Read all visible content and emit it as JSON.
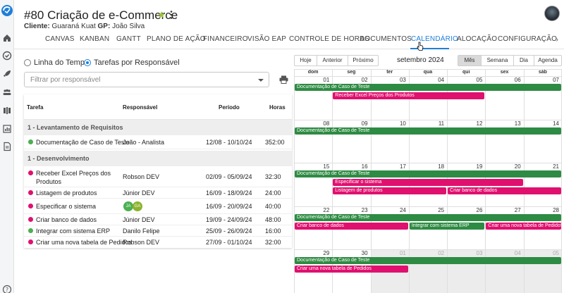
{
  "colors": {
    "accent": "#1e7fd8",
    "event_green": "#2e8b43",
    "event_pink": "#e0106f",
    "status_green": "#4caf50",
    "status_pink": "#e0106f"
  },
  "sidebar": {
    "logo_icon": "app-logo-icon",
    "items": [
      {
        "name": "home-icon"
      },
      {
        "name": "check-circle-icon"
      },
      {
        "name": "rocket-icon"
      },
      {
        "name": "team-icon"
      },
      {
        "name": "layers-icon"
      },
      {
        "name": "chart-icon"
      },
      {
        "name": "document-icon"
      }
    ],
    "help_icon": "help-icon"
  },
  "header": {
    "title": "#80 Criação de e-Commerce",
    "client_label": "Cliente:",
    "client_value": "Guaraná Kuat",
    "gp_label": "GP:",
    "gp_value": "João Silva"
  },
  "tabs": [
    {
      "label": "CANVAS"
    },
    {
      "label": "KANBAN"
    },
    {
      "label": "GANTT"
    },
    {
      "label": "PLANO DE AÇÃO"
    },
    {
      "label": "FINANCEIRO"
    },
    {
      "label": "VISÃO EAP"
    },
    {
      "label": "CONTROLE DE HORAS"
    },
    {
      "label": "DOCUMENTOS"
    },
    {
      "label": "CALENDÁRIO"
    },
    {
      "label": "ALOCAÇÃO"
    },
    {
      "label": "CONFIGURAÇÃO"
    }
  ],
  "tabs_arrow": "›",
  "view_options": {
    "timeline": "Linha do Tempo",
    "by_responsible": "Tarefas por Responsável"
  },
  "filter": {
    "placeholder": "Filtrar por responsável"
  },
  "table": {
    "headers": {
      "task": "Tarefa",
      "responsible": "Responsável",
      "period": "Período",
      "hours": "Horas"
    },
    "groups": [
      {
        "title": "1 - Levantamento de Requisitos",
        "rows": [
          {
            "task": "Documentação de Caso de Teste",
            "responsible": "João - Analista",
            "period": "12/08 - 10/10/24",
            "hours": "352:00",
            "status": "green"
          }
        ]
      },
      {
        "title": "1 - Desenvolvimento",
        "rows": [
          {
            "task": "Receber Excel Preços dos",
            "task2": "Produtos",
            "responsible": "Robson DEV",
            "period": "02/09 - 05/09/24",
            "hours": "32:30",
            "status": "pink"
          },
          {
            "task": "Listagem de produtos",
            "responsible": "Júnior DEV",
            "period": "16/09 - 18/09/24",
            "hours": "24:00",
            "status": "pink"
          },
          {
            "task": "Especificar o sistema",
            "chips": [
              "JA",
              "GA"
            ],
            "period": "16/09 - 20/09/24",
            "hours": "40:00",
            "status": "pink"
          },
          {
            "task": "Criar banco de dados",
            "responsible": "Júnior DEV",
            "period": "19/09 - 24/09/24",
            "hours": "48:00",
            "status": "pink"
          },
          {
            "task": "Integrar com sistema ERP",
            "responsible": "Danilo Felipe",
            "period": "25/09 - 26/09/24",
            "hours": "16:00",
            "status": "green"
          },
          {
            "task": "Criar uma nova tabela de Pedidos",
            "responsible": "Robson DEV",
            "period": "27/09 - 01/10/24",
            "hours": "32:00",
            "status": "pink"
          }
        ]
      }
    ]
  },
  "calendar": {
    "nav": {
      "today": "Hoje",
      "prev": "Anterior",
      "next": "Próximo"
    },
    "title": "setembro 2024",
    "views": {
      "month": "Mês",
      "week": "Semana",
      "day": "Dia",
      "agenda": "Agenda"
    },
    "weekdays": [
      "dom",
      "seg",
      "ter",
      "qua",
      "qui",
      "sex",
      "sáb"
    ],
    "weeks": [
      {
        "days": [
          "01",
          "02",
          "03",
          "04",
          "05",
          "06",
          "07"
        ]
      },
      {
        "days": [
          "08",
          "09",
          "10",
          "11",
          "12",
          "13",
          "14"
        ]
      },
      {
        "days": [
          "15",
          "16",
          "17",
          "18",
          "19",
          "20",
          "21"
        ]
      },
      {
        "days": [
          "22",
          "23",
          "24",
          "25",
          "26",
          "27",
          "28"
        ]
      },
      {
        "days": [
          "29",
          "30",
          "01",
          "02",
          "03",
          "04",
          "05"
        ]
      }
    ],
    "events": [
      {
        "week": 0,
        "start": 0,
        "span": 7,
        "lane": 0,
        "color": "green",
        "label": "Documentação de Caso de Teste"
      },
      {
        "week": 0,
        "start": 1,
        "span": 4,
        "lane": 1,
        "color": "pink",
        "label": "Receber Excel Preços dos Produtos"
      },
      {
        "week": 1,
        "start": 0,
        "span": 7,
        "lane": 0,
        "color": "green",
        "label": "Documentação de Caso de Teste"
      },
      {
        "week": 2,
        "start": 0,
        "span": 7,
        "lane": 0,
        "color": "green",
        "label": "Documentação de Caso de Teste"
      },
      {
        "week": 2,
        "start": 1,
        "span": 5,
        "lane": 1,
        "color": "pink",
        "label": "Especificar o sistema"
      },
      {
        "week": 2,
        "start": 1,
        "span": 3,
        "lane": 2,
        "color": "pink",
        "label": "Listagem de produtos"
      },
      {
        "week": 2,
        "start": 4,
        "span": 3,
        "lane": 2,
        "color": "pink",
        "label": "Criar banco de dados"
      },
      {
        "week": 3,
        "start": 0,
        "span": 7,
        "lane": 0,
        "color": "green",
        "label": "Documentação de Caso de Teste"
      },
      {
        "week": 3,
        "start": 0,
        "span": 3,
        "lane": 1,
        "color": "pink",
        "label": "Criar banco de dados"
      },
      {
        "week": 3,
        "start": 3,
        "span": 2,
        "lane": 1,
        "color": "green",
        "label": "Integrar com sistema ERP"
      },
      {
        "week": 3,
        "start": 5,
        "span": 2,
        "lane": 1,
        "color": "pink",
        "label": "Criar uma nova tabela de Pedidos"
      },
      {
        "week": 4,
        "start": 0,
        "span": 7,
        "lane": 0,
        "color": "green",
        "label": "Documentação de Caso de Teste"
      },
      {
        "week": 4,
        "start": 0,
        "span": 3,
        "lane": 1,
        "color": "pink",
        "label": "Criar uma nova tabela de Pedidos"
      }
    ]
  }
}
